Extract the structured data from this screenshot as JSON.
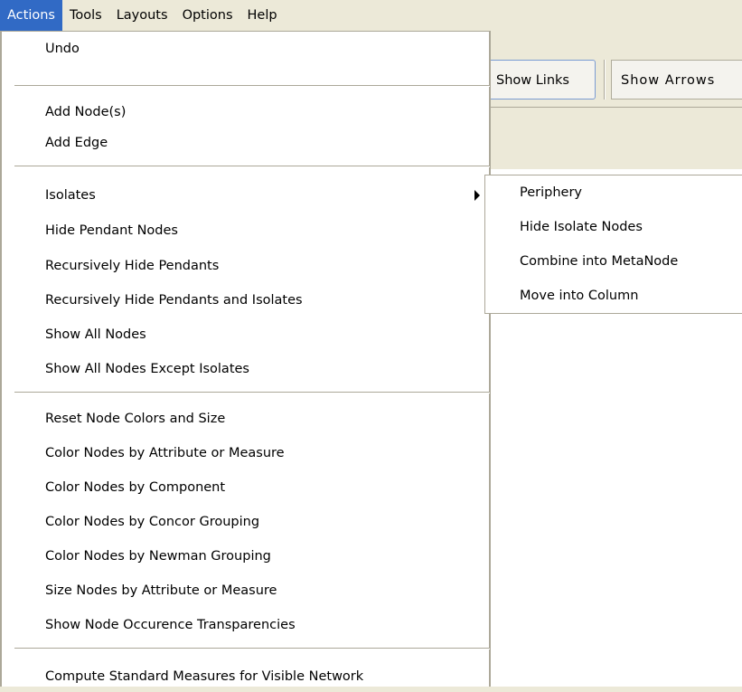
{
  "menubar": {
    "items": [
      "Actions",
      "Tools",
      "Layouts",
      "Options",
      "Help"
    ]
  },
  "toolbar": {
    "show_links": "Show Links",
    "show_arrows": "Show Arrows"
  },
  "actions_menu": {
    "undo": "Undo",
    "add_nodes": "Add Node(s)",
    "add_edge": "Add Edge",
    "isolates": "Isolates",
    "hide_pendant_nodes": "Hide Pendant Nodes",
    "recursively_hide_pendants": "Recursively Hide Pendants",
    "recursively_hide_pendants_isolates": "Recursively Hide Pendants and Isolates",
    "show_all_nodes": "Show All Nodes",
    "show_all_except_isolates": "Show All Nodes Except Isolates",
    "reset_node_colors": "Reset Node Colors and Size",
    "color_by_attribute": "Color Nodes by Attribute or Measure",
    "color_by_component": "Color Nodes by Component",
    "color_by_concor": "Color Nodes by Concor Grouping",
    "color_by_newman": "Color Nodes by Newman Grouping",
    "size_by_attribute": "Size Nodes by Attribute or Measure",
    "show_occurence_transparencies": "Show Node Occurence Transparencies",
    "compute_standard_measures": "Compute Standard Measures for Visible Network"
  },
  "isolates_submenu": {
    "periphery": "Periphery",
    "hide_isolate_nodes": "Hide Isolate Nodes",
    "combine_metanode": "Combine into MetaNode",
    "move_into_column": "Move into Column"
  }
}
